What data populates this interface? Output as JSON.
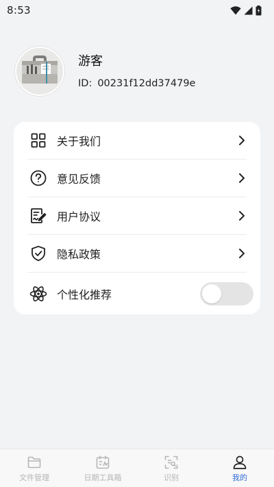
{
  "status_bar": {
    "time": "8:53",
    "icons": [
      "wifi-icon",
      "signal-icon",
      "battery-icon"
    ]
  },
  "profile": {
    "name": "游客",
    "id_label": "ID:",
    "id_value": "00231f12dd37479e",
    "avatar_icon": "toolbox-icon"
  },
  "menu": {
    "items": [
      {
        "label": "关于我们",
        "icon": "grid-icon"
      },
      {
        "label": "意见反馈",
        "icon": "question-circle-icon"
      },
      {
        "label": "用户协议",
        "icon": "document-edit-icon"
      },
      {
        "label": "隐私政策",
        "icon": "shield-check-icon"
      }
    ],
    "toggle_item": {
      "label": "个性化推荐",
      "icon": "atom-icon",
      "enabled": false
    }
  },
  "tabbar": {
    "tabs": [
      {
        "label": "文件管理",
        "icon": "folder-icon",
        "active": false
      },
      {
        "label": "日期工具箱",
        "icon": "calendar-icon",
        "active": false
      },
      {
        "label": "识别",
        "icon": "scan-icon",
        "active": false
      },
      {
        "label": "我的",
        "icon": "user-icon",
        "active": true
      }
    ]
  },
  "colors": {
    "background": "#f1f3f5",
    "card": "#ffffff",
    "accent": "#2f6bd8",
    "inactive": "#b5b5b5",
    "toggle_off": "#e4e4e4"
  }
}
